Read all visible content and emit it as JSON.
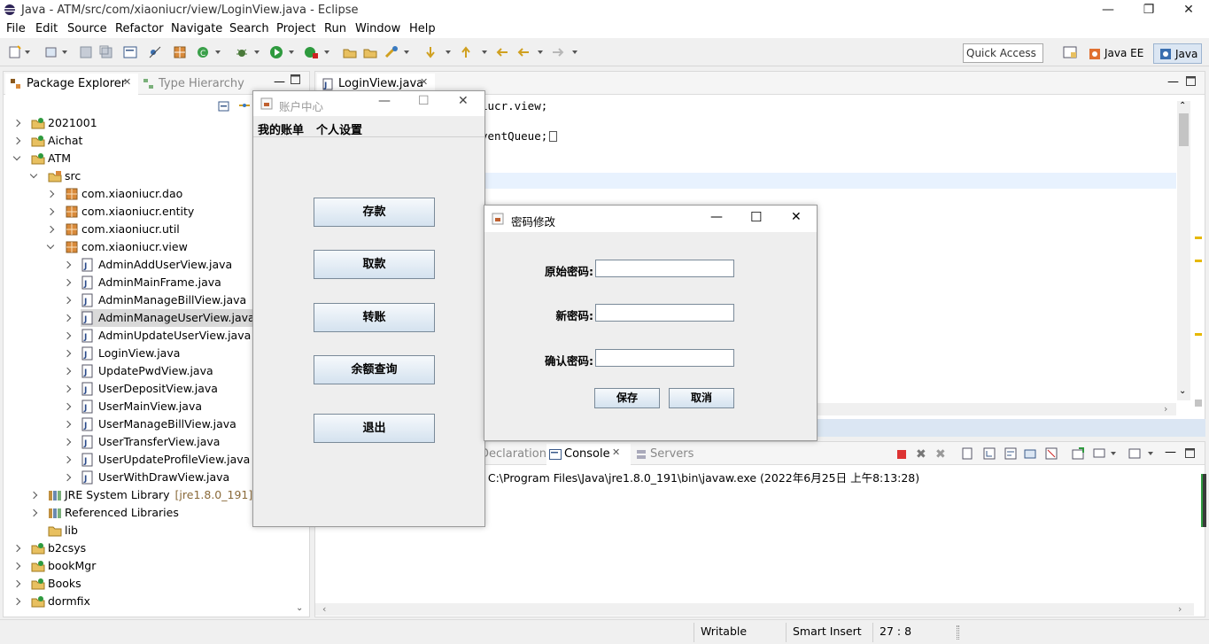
{
  "window": {
    "title": "Java - ATM/src/com/xiaoniucr/view/LoginView.java - Eclipse"
  },
  "menu": [
    "File",
    "Edit",
    "Source",
    "Refactor",
    "Navigate",
    "Search",
    "Project",
    "Run",
    "Window",
    "Help"
  ],
  "toolbar": {
    "quick_access": "Quick Access",
    "perspectives": [
      "Java EE",
      "Java"
    ]
  },
  "explorer": {
    "tabs": [
      "Package Explorer",
      "Type Hierarchy"
    ],
    "rows": [
      {
        "label": "2021001",
        "level": 0,
        "exp": "r",
        "icon": "project-icon"
      },
      {
        "label": "Aichat",
        "level": 0,
        "exp": "r",
        "icon": "project-icon"
      },
      {
        "label": "ATM",
        "level": 0,
        "exp": "d",
        "icon": "project-icon"
      },
      {
        "label": "src",
        "level": 1,
        "exp": "d",
        "icon": "source-folder-icon"
      },
      {
        "label": "com.xiaoniucr.dao",
        "level": 2,
        "exp": "r",
        "icon": "package-icon"
      },
      {
        "label": "com.xiaoniucr.entity",
        "level": 2,
        "exp": "r",
        "icon": "package-icon"
      },
      {
        "label": "com.xiaoniucr.util",
        "level": 2,
        "exp": "r",
        "icon": "package-icon"
      },
      {
        "label": "com.xiaoniucr.view",
        "level": 2,
        "exp": "d",
        "icon": "package-icon"
      },
      {
        "label": "AdminAddUserView.java",
        "level": 3,
        "exp": "r",
        "icon": "java-file-icon"
      },
      {
        "label": "AdminMainFrame.java",
        "level": 3,
        "exp": "r",
        "icon": "java-file-icon"
      },
      {
        "label": "AdminManageBillView.java",
        "level": 3,
        "exp": "r",
        "icon": "java-file-icon"
      },
      {
        "label": "AdminManageUserView.java",
        "level": 3,
        "exp": "r",
        "icon": "java-file-icon",
        "selected": true
      },
      {
        "label": "AdminUpdateUserView.java",
        "level": 3,
        "exp": "r",
        "icon": "java-file-icon"
      },
      {
        "label": "LoginView.java",
        "level": 3,
        "exp": "r",
        "icon": "java-file-icon"
      },
      {
        "label": "UpdatePwdView.java",
        "level": 3,
        "exp": "r",
        "icon": "java-file-icon"
      },
      {
        "label": "UserDepositView.java",
        "level": 3,
        "exp": "r",
        "icon": "java-file-icon"
      },
      {
        "label": "UserMainView.java",
        "level": 3,
        "exp": "r",
        "icon": "java-file-icon"
      },
      {
        "label": "UserManageBillView.java",
        "level": 3,
        "exp": "r",
        "icon": "java-file-icon"
      },
      {
        "label": "UserTransferView.java",
        "level": 3,
        "exp": "r",
        "icon": "java-file-icon"
      },
      {
        "label": "UserUpdateProfileView.java",
        "level": 3,
        "exp": "r",
        "icon": "java-file-icon"
      },
      {
        "label": "UserWithDrawView.java",
        "level": 3,
        "exp": "r",
        "icon": "java-file-icon"
      },
      {
        "label": "JRE System Library",
        "suffix": "[jre1.8.0_191]",
        "level": 1,
        "exp": "r",
        "icon": "library-icon"
      },
      {
        "label": "Referenced Libraries",
        "level": 1,
        "exp": "r",
        "icon": "library-icon"
      },
      {
        "label": "lib",
        "level": 1,
        "exp": "",
        "icon": "folder-icon"
      },
      {
        "label": "b2csys",
        "level": 0,
        "exp": "r",
        "icon": "project-icon"
      },
      {
        "label": "bookMgr",
        "level": 0,
        "exp": "r",
        "icon": "project-icon"
      },
      {
        "label": "Books",
        "level": 0,
        "exp": "r",
        "icon": "project-icon"
      },
      {
        "label": "dormfix",
        "level": 0,
        "exp": "r",
        "icon": "project-icon"
      }
    ]
  },
  "editor": {
    "tab": "LoginView.java",
    "lines": [
      {
        "text": "iucr.view;"
      },
      {
        "text": "ventQueue;"
      }
    ]
  },
  "console": {
    "tabs": [
      "Declaration",
      "Console",
      "Servers"
    ],
    "text": "] C:\\Program Files\\Java\\jre1.8.0_191\\bin\\javaw.exe (2022年6月25日 上午8:13:28)"
  },
  "account_window": {
    "title": "账户中心",
    "menus": [
      "我的账单",
      "个人设置"
    ],
    "buttons": [
      "存款",
      "取款",
      "转账",
      "余额查询",
      "退出"
    ]
  },
  "password_dialog": {
    "title": "密码修改",
    "fields": [
      "原始密码:",
      "新密码:",
      "确认密码:"
    ],
    "save": "保存",
    "cancel": "取消"
  },
  "status": {
    "writable": "Writable",
    "insert": "Smart Insert",
    "position": "27 : 8"
  }
}
